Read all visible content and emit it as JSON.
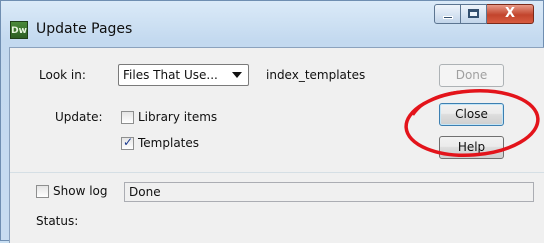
{
  "window": {
    "title": "Update Pages",
    "app_icon_text": "Dw"
  },
  "caption_buttons": {
    "minimize": "minimize",
    "maximize": "maximize",
    "close_glyph": "X"
  },
  "form": {
    "look_in_label": "Look in:",
    "look_in_value": "Files That Use...",
    "look_in_target": "index_templates",
    "update_label": "Update:",
    "library_items_label": "Library items",
    "library_items_checked": false,
    "templates_label": "Templates",
    "templates_checked": true,
    "show_log_label": "Show log",
    "show_log_checked": false,
    "status_field_value": "Done",
    "status_label": "Status:"
  },
  "buttons": {
    "done": "Done",
    "close": "Close",
    "help": "Help"
  },
  "annotation": {
    "shape": "red-ellipse",
    "color": "#e3141b"
  }
}
